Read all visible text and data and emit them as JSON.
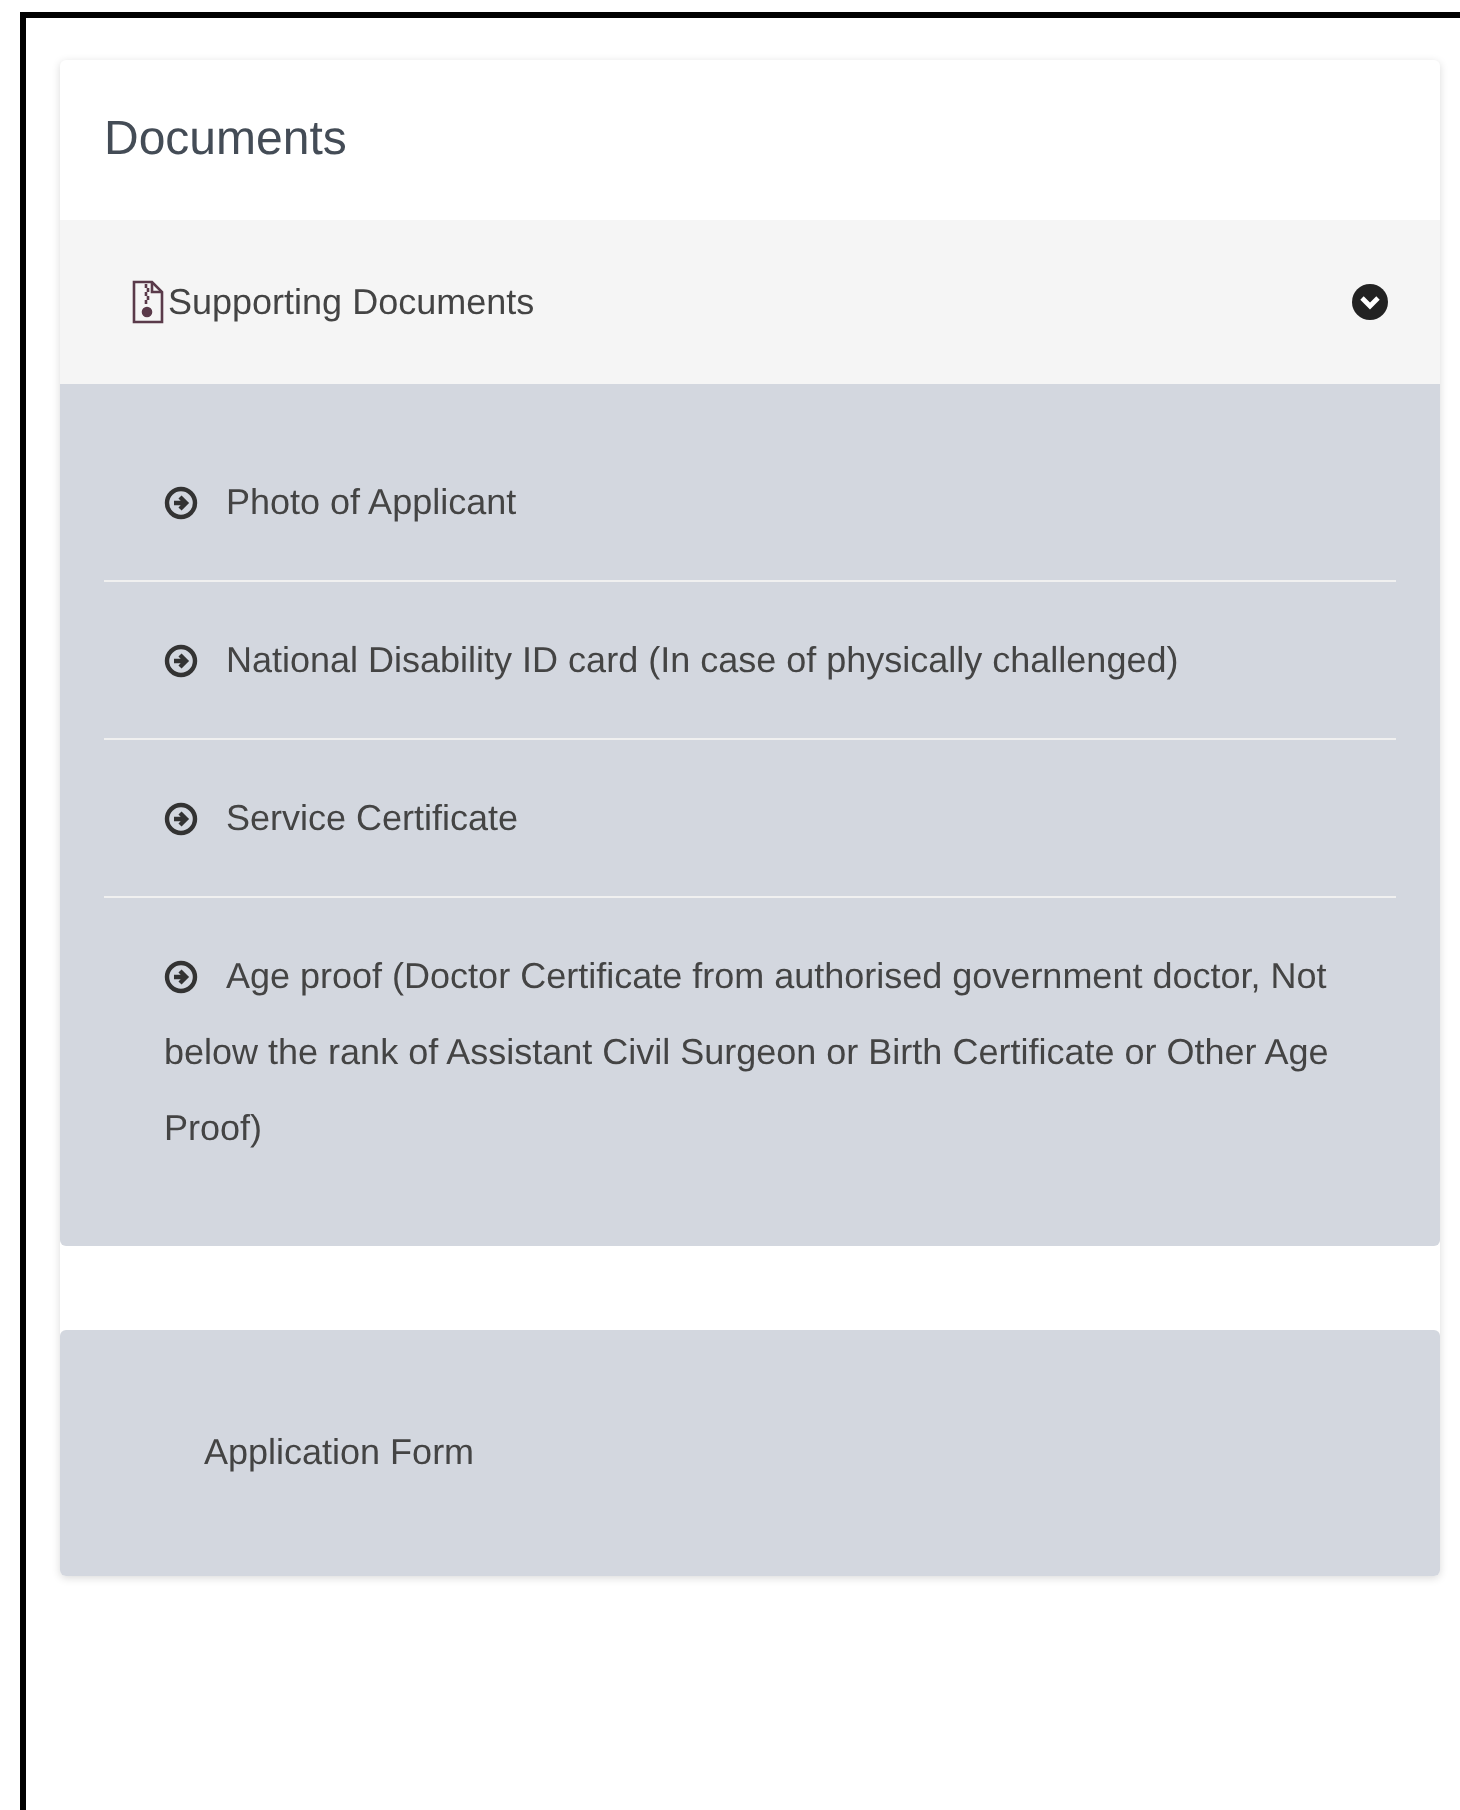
{
  "panel": {
    "title": "Documents"
  },
  "sections": [
    {
      "title": "Supporting Documents",
      "expanded": true,
      "items": [
        "Photo of Applicant",
        "National Disability ID card (In case of physically challenged)",
        "Service Certificate",
        "Age proof (Doctor Certificate from authorised government doctor, Not below the rank of Assistant Civil Surgeon or Birth Certificate or Other Age Proof)"
      ]
    }
  ],
  "application_form": {
    "label": "Application Form"
  }
}
